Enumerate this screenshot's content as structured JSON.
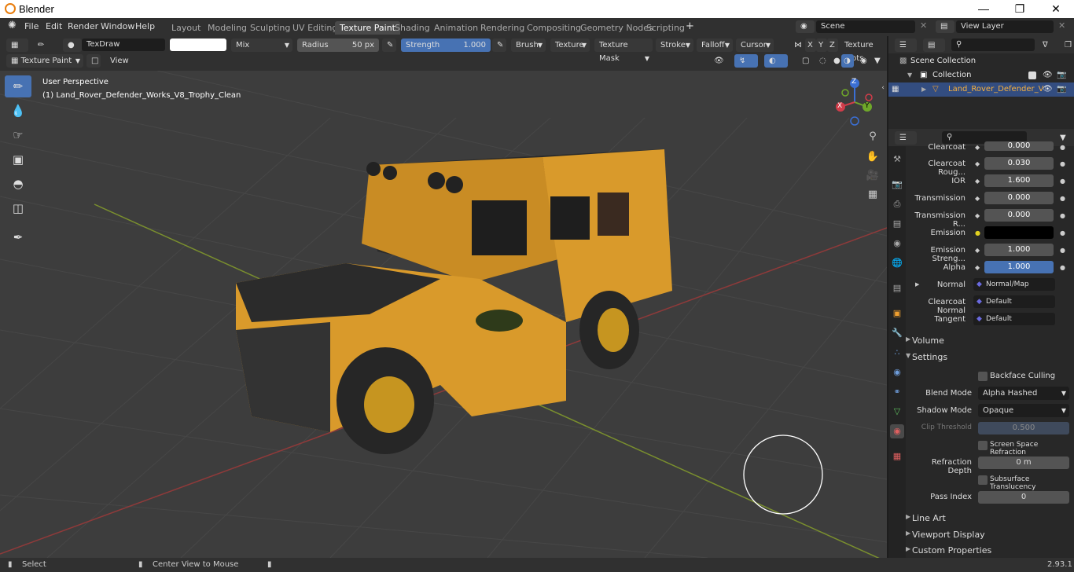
{
  "app_title": "Blender",
  "menu": [
    "File",
    "Edit",
    "Render",
    "Window",
    "Help"
  ],
  "workspace_tabs": [
    "Layout",
    "Modeling",
    "Sculpting",
    "UV Editing",
    "Texture Paint",
    "Shading",
    "Animation",
    "Rendering",
    "Compositing",
    "Geometry Nodes",
    "Scripting"
  ],
  "active_workspace": "Texture Paint",
  "scene": "Scene",
  "view_layer": "View Layer",
  "brush": {
    "name": "TexDraw",
    "blend": "Mix",
    "radius_label": "Radius",
    "radius": "50 px",
    "strength_label": "Strength",
    "strength": "1.000"
  },
  "header_menus": [
    "Brush",
    "Texture",
    "Texture Mask",
    "Stroke",
    "Falloff",
    "Cursor"
  ],
  "axis_buttons": [
    "X",
    "Y",
    "Z"
  ],
  "texture_slots": "Texture Slots",
  "mode": "Texture Paint",
  "view_menu": "View",
  "viewport": {
    "perspective": "User Perspective",
    "object": "(1) Land_Rover_Defender_Works_V8_Trophy_Clean"
  },
  "gizmo": {
    "z": "Z",
    "y": "Y",
    "x": "X"
  },
  "outliner": {
    "scene_collection": "Scene Collection",
    "collection": "Collection",
    "object": "Land_Rover_Defender_V"
  },
  "properties": [
    {
      "label": "Clearcoat",
      "value": "0.000"
    },
    {
      "label": "Clearcoat Roug...",
      "value": "0.030"
    },
    {
      "label": "IOR",
      "value": "1.600"
    },
    {
      "label": "Transmission",
      "value": "0.000"
    },
    {
      "label": "Transmission R...",
      "value": "0.000"
    },
    {
      "label": "Emission",
      "value": ""
    },
    {
      "label": "Emission Streng...",
      "value": "1.000"
    },
    {
      "label": "Alpha",
      "value": "1.000"
    }
  ],
  "links": [
    {
      "label": "Normal",
      "value": "Normal/Map"
    },
    {
      "label": "Clearcoat Normal",
      "value": "Default"
    },
    {
      "label": "Tangent",
      "value": "Default"
    }
  ],
  "sections": {
    "volume": "Volume",
    "settings": "Settings",
    "line_art": "Line Art",
    "viewport_display": "Viewport Display",
    "custom_properties": "Custom Properties"
  },
  "settings": {
    "backface_culling": "Backface Culling",
    "blend_mode_label": "Blend Mode",
    "blend_mode": "Alpha Hashed",
    "shadow_mode_label": "Shadow Mode",
    "shadow_mode": "Opaque",
    "clip_threshold_label": "Clip Threshold",
    "clip_threshold": "0.500",
    "ssr": "Screen Space Refraction",
    "refraction_depth_label": "Refraction Depth",
    "refraction_depth": "0 m",
    "sss": "Subsurface Translucency",
    "pass_index_label": "Pass Index",
    "pass_index": "0"
  },
  "status": {
    "select": "Select",
    "center": "Center View to Mouse",
    "version": "2.93.1"
  },
  "colors": {
    "accent": "#4772b3",
    "body_yellow": "#d99a2b",
    "emission": "#000000"
  }
}
